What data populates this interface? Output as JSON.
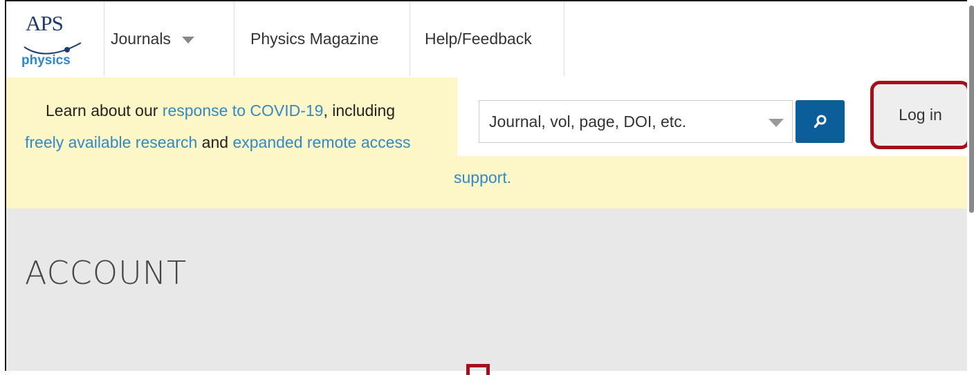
{
  "logo": {
    "top_text": "APS",
    "bottom_text": "physics"
  },
  "nav": {
    "items": [
      {
        "label": "Journals"
      },
      {
        "label": "Physics Magazine"
      },
      {
        "label": "Help/Feedback"
      }
    ]
  },
  "banner": {
    "line1_text": "Learn about our ",
    "line1_link": "response to COVID-19",
    "line1_tail": ", including",
    "line2_link1": "freely available research",
    "line2_mid": " and ",
    "line2_link2": "expanded remote access",
    "line3_link": "support."
  },
  "search": {
    "placeholder": "Journal, vol, page, DOI, etc."
  },
  "login": {
    "label": "Log in"
  },
  "account": {
    "title": "ACCOUNT"
  },
  "colors": {
    "banner_bg": "#fdf6c6",
    "link": "#2f8ac6",
    "search_button": "#0b5e99",
    "highlight": "#a50f1a",
    "section_bg": "#e8e8e8"
  },
  "icons": {
    "search_button": "search-icon",
    "journals_dropdown": "chevron-down-icon",
    "search_dropdown": "chevron-down-icon"
  }
}
